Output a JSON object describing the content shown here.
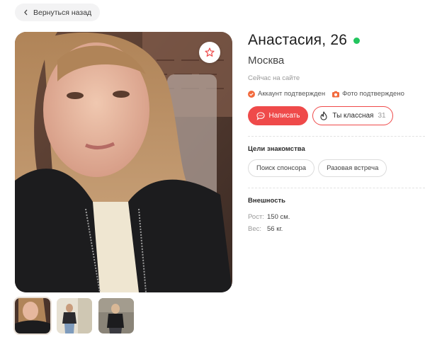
{
  "back": {
    "label": "Вернуться назад"
  },
  "profile": {
    "name_age": "Анастасия, 26",
    "city": "Москва",
    "status": "Сейчас на сайте",
    "badges": [
      {
        "label": "Аккаунт подтвержден",
        "icon": "checkmark-badge-icon"
      },
      {
        "label": "Фото подтверждено",
        "icon": "camera-icon"
      }
    ]
  },
  "actions": {
    "write_label": "Написать",
    "like_label": "Ты классная",
    "like_count": "31"
  },
  "goals": {
    "title": "Цели знакомства",
    "items": [
      "Поиск спонсора",
      "Разовая встреча"
    ]
  },
  "appearance": {
    "title": "Внешность",
    "rows": [
      {
        "key": "Рост:",
        "value": "150 см."
      },
      {
        "key": "Вес:",
        "value": "56 кг."
      }
    ]
  },
  "colors": {
    "accent": "#ef4a4a",
    "online": "#22c55e",
    "verified": "#f26a3d"
  },
  "photos": {
    "count": 3,
    "active_index": 0
  }
}
